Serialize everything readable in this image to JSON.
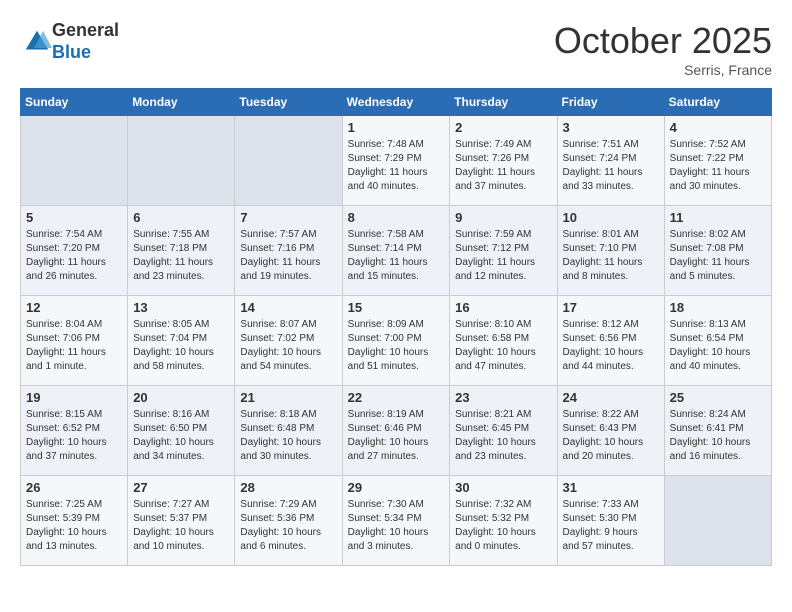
{
  "logo": {
    "general": "General",
    "blue": "Blue"
  },
  "title": "October 2025",
  "location": "Serris, France",
  "days_header": [
    "Sunday",
    "Monday",
    "Tuesday",
    "Wednesday",
    "Thursday",
    "Friday",
    "Saturday"
  ],
  "weeks": [
    [
      {
        "num": "",
        "info": ""
      },
      {
        "num": "",
        "info": ""
      },
      {
        "num": "",
        "info": ""
      },
      {
        "num": "1",
        "info": "Sunrise: 7:48 AM\nSunset: 7:29 PM\nDaylight: 11 hours\nand 40 minutes."
      },
      {
        "num": "2",
        "info": "Sunrise: 7:49 AM\nSunset: 7:26 PM\nDaylight: 11 hours\nand 37 minutes."
      },
      {
        "num": "3",
        "info": "Sunrise: 7:51 AM\nSunset: 7:24 PM\nDaylight: 11 hours\nand 33 minutes."
      },
      {
        "num": "4",
        "info": "Sunrise: 7:52 AM\nSunset: 7:22 PM\nDaylight: 11 hours\nand 30 minutes."
      }
    ],
    [
      {
        "num": "5",
        "info": "Sunrise: 7:54 AM\nSunset: 7:20 PM\nDaylight: 11 hours\nand 26 minutes."
      },
      {
        "num": "6",
        "info": "Sunrise: 7:55 AM\nSunset: 7:18 PM\nDaylight: 11 hours\nand 23 minutes."
      },
      {
        "num": "7",
        "info": "Sunrise: 7:57 AM\nSunset: 7:16 PM\nDaylight: 11 hours\nand 19 minutes."
      },
      {
        "num": "8",
        "info": "Sunrise: 7:58 AM\nSunset: 7:14 PM\nDaylight: 11 hours\nand 15 minutes."
      },
      {
        "num": "9",
        "info": "Sunrise: 7:59 AM\nSunset: 7:12 PM\nDaylight: 11 hours\nand 12 minutes."
      },
      {
        "num": "10",
        "info": "Sunrise: 8:01 AM\nSunset: 7:10 PM\nDaylight: 11 hours\nand 8 minutes."
      },
      {
        "num": "11",
        "info": "Sunrise: 8:02 AM\nSunset: 7:08 PM\nDaylight: 11 hours\nand 5 minutes."
      }
    ],
    [
      {
        "num": "12",
        "info": "Sunrise: 8:04 AM\nSunset: 7:06 PM\nDaylight: 11 hours\nand 1 minute."
      },
      {
        "num": "13",
        "info": "Sunrise: 8:05 AM\nSunset: 7:04 PM\nDaylight: 10 hours\nand 58 minutes."
      },
      {
        "num": "14",
        "info": "Sunrise: 8:07 AM\nSunset: 7:02 PM\nDaylight: 10 hours\nand 54 minutes."
      },
      {
        "num": "15",
        "info": "Sunrise: 8:09 AM\nSunset: 7:00 PM\nDaylight: 10 hours\nand 51 minutes."
      },
      {
        "num": "16",
        "info": "Sunrise: 8:10 AM\nSunset: 6:58 PM\nDaylight: 10 hours\nand 47 minutes."
      },
      {
        "num": "17",
        "info": "Sunrise: 8:12 AM\nSunset: 6:56 PM\nDaylight: 10 hours\nand 44 minutes."
      },
      {
        "num": "18",
        "info": "Sunrise: 8:13 AM\nSunset: 6:54 PM\nDaylight: 10 hours\nand 40 minutes."
      }
    ],
    [
      {
        "num": "19",
        "info": "Sunrise: 8:15 AM\nSunset: 6:52 PM\nDaylight: 10 hours\nand 37 minutes."
      },
      {
        "num": "20",
        "info": "Sunrise: 8:16 AM\nSunset: 6:50 PM\nDaylight: 10 hours\nand 34 minutes."
      },
      {
        "num": "21",
        "info": "Sunrise: 8:18 AM\nSunset: 6:48 PM\nDaylight: 10 hours\nand 30 minutes."
      },
      {
        "num": "22",
        "info": "Sunrise: 8:19 AM\nSunset: 6:46 PM\nDaylight: 10 hours\nand 27 minutes."
      },
      {
        "num": "23",
        "info": "Sunrise: 8:21 AM\nSunset: 6:45 PM\nDaylight: 10 hours\nand 23 minutes."
      },
      {
        "num": "24",
        "info": "Sunrise: 8:22 AM\nSunset: 6:43 PM\nDaylight: 10 hours\nand 20 minutes."
      },
      {
        "num": "25",
        "info": "Sunrise: 8:24 AM\nSunset: 6:41 PM\nDaylight: 10 hours\nand 16 minutes."
      }
    ],
    [
      {
        "num": "26",
        "info": "Sunrise: 7:25 AM\nSunset: 5:39 PM\nDaylight: 10 hours\nand 13 minutes."
      },
      {
        "num": "27",
        "info": "Sunrise: 7:27 AM\nSunset: 5:37 PM\nDaylight: 10 hours\nand 10 minutes."
      },
      {
        "num": "28",
        "info": "Sunrise: 7:29 AM\nSunset: 5:36 PM\nDaylight: 10 hours\nand 6 minutes."
      },
      {
        "num": "29",
        "info": "Sunrise: 7:30 AM\nSunset: 5:34 PM\nDaylight: 10 hours\nand 3 minutes."
      },
      {
        "num": "30",
        "info": "Sunrise: 7:32 AM\nSunset: 5:32 PM\nDaylight: 10 hours\nand 0 minutes."
      },
      {
        "num": "31",
        "info": "Sunrise: 7:33 AM\nSunset: 5:30 PM\nDaylight: 9 hours\nand 57 minutes."
      },
      {
        "num": "",
        "info": ""
      }
    ]
  ]
}
